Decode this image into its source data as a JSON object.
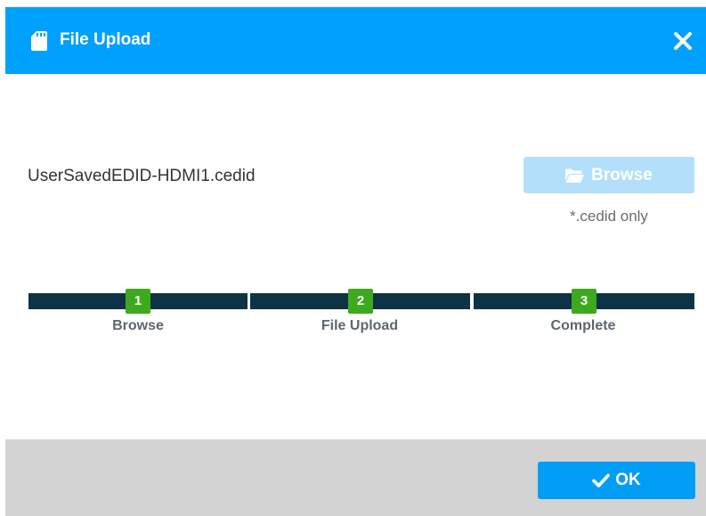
{
  "dialog": {
    "title": "File Upload",
    "title_icon": "file-icon",
    "close_icon": "close-icon"
  },
  "upload": {
    "file_name": "UserSavedEDID-HDMI1.cedid",
    "browse_label": "Browse",
    "browse_icon": "folder-open-icon",
    "file_hint": "*.cedid only"
  },
  "steps": [
    {
      "number": "1",
      "label": "Browse"
    },
    {
      "number": "2",
      "label": "File Upload"
    },
    {
      "number": "3",
      "label": "Complete"
    }
  ],
  "footer": {
    "ok_label": "OK",
    "ok_icon": "check-icon"
  },
  "colors": {
    "header": "#00a0ff",
    "step_bar": "#0e3344",
    "step_badge": "#3daa1e",
    "browse_disabled": "#b3dffb",
    "ok_button": "#009ff5",
    "footer": "#d3d3d3"
  }
}
